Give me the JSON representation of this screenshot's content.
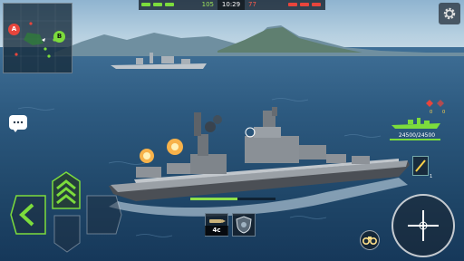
{
  "hud": {
    "score_left": "105",
    "match_timer": "10:29",
    "score_right": "77",
    "team_color_ally": "#7cdc3c",
    "team_color_enemy": "#e8453c"
  },
  "minimap": {
    "point_a": "A",
    "point_b": "B",
    "color_a": "#e8453c",
    "color_b": "#7cdc3c"
  },
  "icons": {
    "settings": "gear-icon",
    "chat": "chat-bubble-icon",
    "binoculars": "binoculars-icon",
    "crosshair": "crosshair-icon",
    "shell": "shell-icon",
    "shield": "shield-icon"
  },
  "enemy_target": {
    "hp_text": "24500/24500",
    "hp_fraction": 1.0,
    "stat_a": "0",
    "stat_b": "0"
  },
  "weapons": {
    "ammo_count": "4c",
    "reload_fraction": 0.55,
    "torpedo_count": "1"
  }
}
